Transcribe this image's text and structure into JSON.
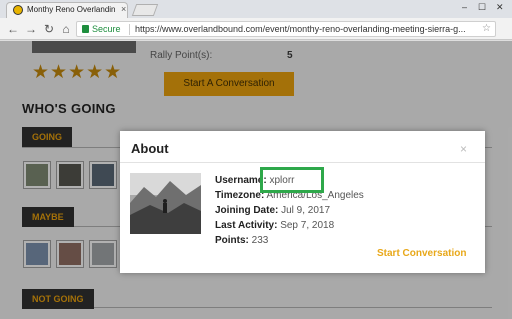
{
  "browser": {
    "tab_title": "Monthy Reno Overlanding M",
    "tab_close": "×",
    "secure_label": "Secure",
    "url": "https://www.overlandbound.com/event/monthy-reno-overlanding-meeting-sierra-g..."
  },
  "page": {
    "rally_points_label": "Rally Point(s):",
    "rally_points_value": "5",
    "rating_stars": "★★★★★",
    "start_conversation_button": "Start A Conversation",
    "whos_going_heading": "WHO'S GOING",
    "sections": {
      "going": "GOING",
      "maybe": "MAYBE",
      "not_going": "NOT GOING"
    }
  },
  "modal": {
    "title": "About",
    "close": "×",
    "fields": [
      {
        "label": "Username:",
        "value": "xplorr"
      },
      {
        "label": "Timezone:",
        "value": "America/Los_Angeles"
      },
      {
        "label": "Joining Date:",
        "value": "Jul 9, 2017"
      },
      {
        "label": "Last Activity:",
        "value": "Sep 7, 2018"
      },
      {
        "label": "Points:",
        "value": "233"
      }
    ],
    "start_conversation": "Start Conversation"
  },
  "colors": {
    "accent": "#e8a81a",
    "highlight_box": "#2ea84a",
    "secure_green": "#1e8e3e"
  }
}
